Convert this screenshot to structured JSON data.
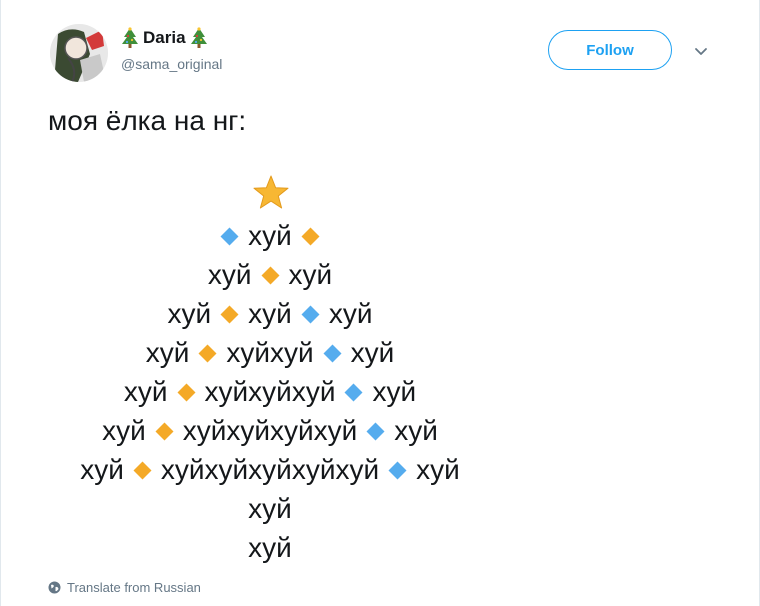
{
  "author": {
    "display_name": "Daria",
    "handle": "@sama_original",
    "name_emoji": "christmas-tree-icon"
  },
  "follow_label": "Follow",
  "tweet_text": "моя ёлка на нг:",
  "tree": {
    "top_icon": "star-icon",
    "lines": [
      [
        "◆b",
        "хуй",
        "◆o"
      ],
      [
        "хуй",
        "◆o",
        "хуй"
      ],
      [
        "хуй",
        "◆o",
        "хуй",
        "◆b",
        "хуй"
      ],
      [
        "хуй",
        "◆o",
        "хуйхуй",
        "◆b",
        "хуй"
      ],
      [
        "хуй",
        "◆o",
        "хуйхуйхуй",
        "◆b",
        "хуй"
      ],
      [
        "хуй",
        "◆o",
        "хуйхуйхуйхуй",
        "◆b",
        "хуй"
      ],
      [
        "хуй",
        "◆o",
        "хуйхуйхуйхуйхуй",
        "◆b",
        "хуй"
      ],
      [
        "хуй"
      ],
      [
        "хуй"
      ]
    ],
    "colors": {
      "orange": "#f4a927",
      "blue": "#55acee",
      "star": "#f7b733"
    }
  },
  "translate_label": "Translate from Russian",
  "colors": {
    "accent": "#1da1f2",
    "text": "#14171a",
    "secondary": "#657786"
  }
}
